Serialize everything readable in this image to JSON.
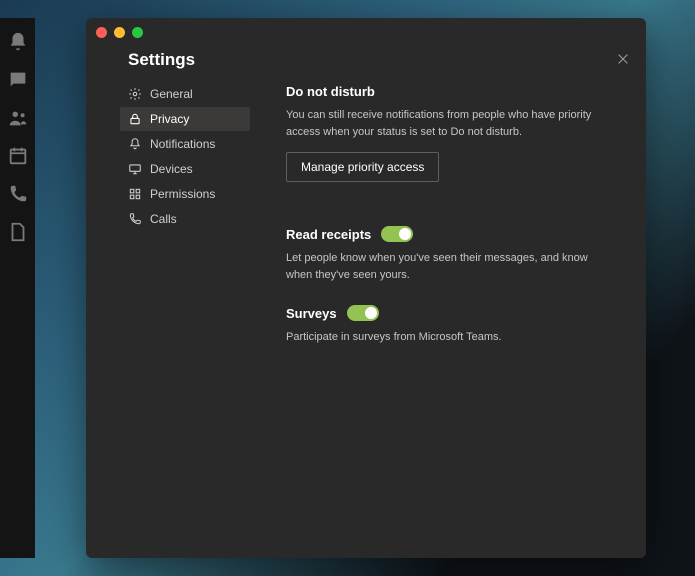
{
  "window": {
    "title": "Settings"
  },
  "nav": {
    "items": [
      {
        "label": "General"
      },
      {
        "label": "Privacy"
      },
      {
        "label": "Notifications"
      },
      {
        "label": "Devices"
      },
      {
        "label": "Permissions"
      },
      {
        "label": "Calls"
      }
    ]
  },
  "content": {
    "dnd": {
      "heading": "Do not disturb",
      "desc": "You can still receive notifications from people who have priority access when your status is set to Do not disturb.",
      "button": "Manage priority access"
    },
    "read_receipts": {
      "heading": "Read receipts",
      "desc": "Let people know when you've seen their messages, and know when they've seen yours."
    },
    "surveys": {
      "heading": "Surveys",
      "desc": "Participate in surveys from Microsoft Teams."
    }
  }
}
